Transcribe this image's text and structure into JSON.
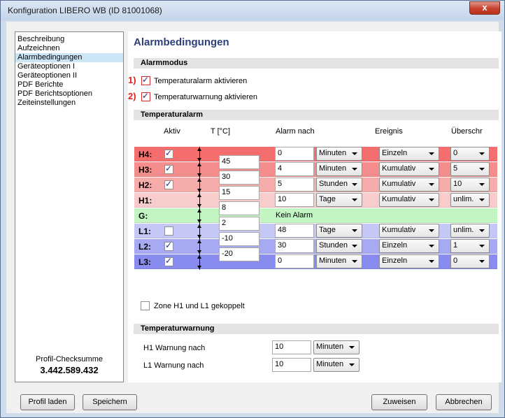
{
  "window": {
    "title": "Konfiguration LIBERO WB (ID 81001068)",
    "close_label": "x"
  },
  "sidebar": {
    "items": [
      {
        "label": "Beschreibung"
      },
      {
        "label": "Aufzeichnen"
      },
      {
        "label": "Alarmbedingungen",
        "selected": true
      },
      {
        "label": "Geräteoptionen I"
      },
      {
        "label": "Geräteoptionen II"
      },
      {
        "label": "PDF Berichte"
      },
      {
        "label": "PDF Berichtsoptionen"
      },
      {
        "label": "Zeiteinstellungen"
      }
    ],
    "checksum_label": "Profil-Checksumme",
    "checksum_value": "3.442.589.432"
  },
  "main": {
    "title": "Alarmbedingungen",
    "alarmmodus": {
      "header": "Alarmmodus",
      "options": [
        {
          "marker": "1)",
          "label": "Temperaturalarm aktivieren",
          "checked": true
        },
        {
          "marker": "2)",
          "label": "Temperaturwarnung aktivieren",
          "checked": true
        }
      ]
    },
    "temperaturalarm": {
      "header": "Temperaturalarm",
      "columns": {
        "aktiv": "Aktiv",
        "temp": "T [°C]",
        "alarm_nach": "Alarm nach",
        "ereignis": "Ereignis",
        "ueberschr": "Überschr"
      },
      "zones": [
        {
          "name": "H4:",
          "has_check": true,
          "checked": true,
          "alarm_value": "0",
          "unit": "Minuten",
          "ereignis": "Einzeln",
          "ueberschr": "0",
          "color": "#f46e6e"
        },
        {
          "name": "H3:",
          "has_check": true,
          "checked": true,
          "alarm_value": "4",
          "unit": "Minuten",
          "ereignis": "Kumulativ",
          "ueberschr": "5",
          "color": "#f58d8d"
        },
        {
          "name": "H2:",
          "has_check": true,
          "checked": true,
          "alarm_value": "5",
          "unit": "Stunden",
          "ereignis": "Kumulativ",
          "ueberschr": "10",
          "color": "#f7acac"
        },
        {
          "name": "H1:",
          "has_check": false,
          "checked": false,
          "alarm_value": "10",
          "unit": "Tage",
          "ereignis": "Kumulativ",
          "ueberschr": "unlim.",
          "color": "#f9cccc"
        },
        {
          "name": "G:",
          "has_check": false,
          "checked": false,
          "kein_alarm": "Kein Alarm",
          "color": "#c3f5c3"
        },
        {
          "name": "L1:",
          "has_check": true,
          "checked": false,
          "alarm_value": "48",
          "unit": "Tage",
          "ereignis": "Kumulativ",
          "ueberschr": "unlim.",
          "color": "#c5c8f6"
        },
        {
          "name": "L2:",
          "has_check": true,
          "checked": true,
          "alarm_value": "30",
          "unit": "Stunden",
          "ereignis": "Einzeln",
          "ueberschr": "1",
          "color": "#a6aaf3"
        },
        {
          "name": "L3:",
          "has_check": true,
          "checked": true,
          "alarm_value": "0",
          "unit": "Minuten",
          "ereignis": "Einzeln",
          "ueberschr": "0",
          "color": "#888cef"
        }
      ],
      "thresholds": [
        "45",
        "30",
        "15",
        "8",
        "2",
        "-10",
        "-20"
      ],
      "coupled_label": "Zone H1 und L1 gekoppelt",
      "coupled_checked": false
    },
    "temperaturwarnung": {
      "header": "Temperaturwarnung",
      "rows": [
        {
          "label": "H1 Warnung nach",
          "value": "10",
          "unit": "Minuten"
        },
        {
          "label": "L1 Warnung nach",
          "value": "10",
          "unit": "Minuten"
        }
      ]
    }
  },
  "footer": {
    "profil_laden": "Profil laden",
    "speichern": "Speichern",
    "zuweisen": "Zuweisen",
    "abbrechen": "Abbrechen"
  }
}
